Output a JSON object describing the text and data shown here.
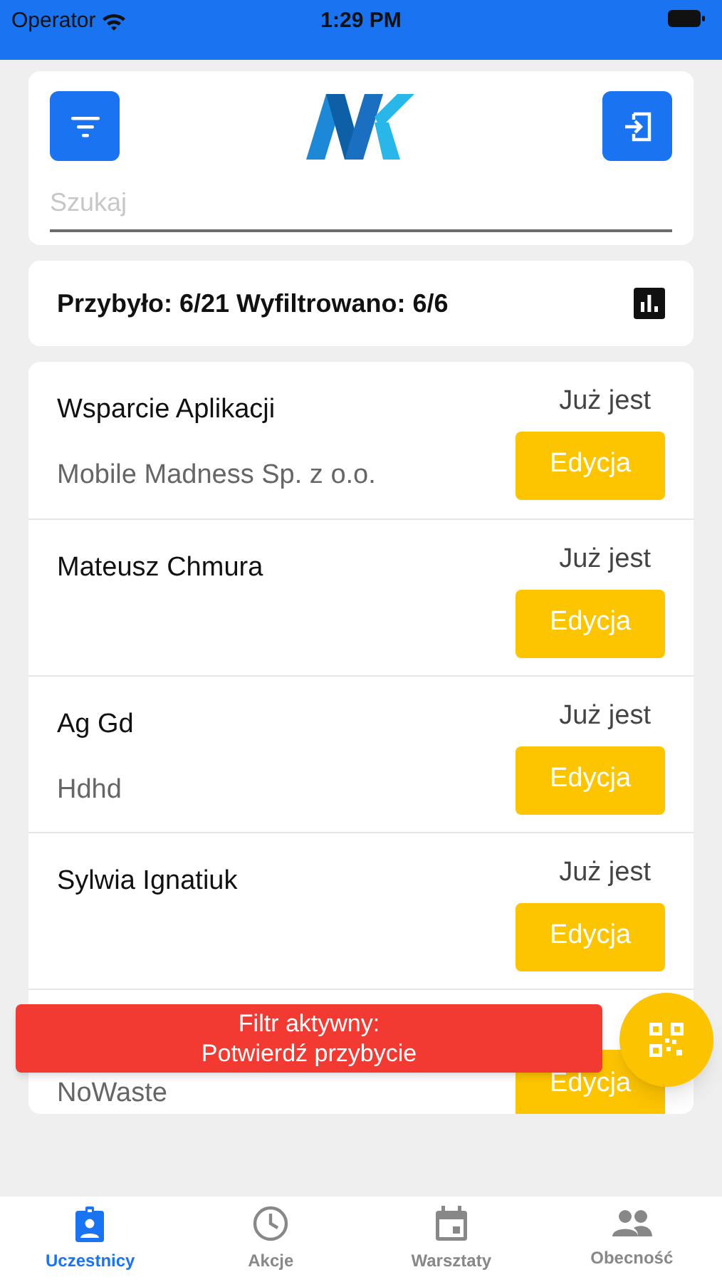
{
  "status_bar": {
    "carrier": "Operator",
    "time": "1:29 PM"
  },
  "search": {
    "placeholder": "Szukaj"
  },
  "stats": {
    "text": "Przybyło: 6/21 Wyfiltrowano: 6/6"
  },
  "participants": [
    {
      "name": "Wsparcie Aplikacji",
      "company": "Mobile Madness Sp. z o.o.",
      "status": "Już jest",
      "button": "Edycja"
    },
    {
      "name": "Mateusz Chmura",
      "status": "Już jest",
      "button": "Edycja"
    },
    {
      "name": "Ag Gd",
      "company": "Hdhd",
      "status": "Już jest",
      "button": "Edycja"
    },
    {
      "name": "Sylwia Ignatiuk",
      "status": "Już jest",
      "button": "Edycja"
    },
    {
      "company": "NoWaste",
      "button": "Edycja"
    }
  ],
  "toast": {
    "lines": [
      "Filtr aktywny:",
      "Potwierdź przybycie"
    ]
  },
  "tabs": [
    {
      "label": "Uczestnicy",
      "selected": true
    },
    {
      "label": "Akcje",
      "selected": false
    },
    {
      "label": "Warsztaty",
      "selected": false
    },
    {
      "label": "Obecność",
      "selected": false
    }
  ]
}
